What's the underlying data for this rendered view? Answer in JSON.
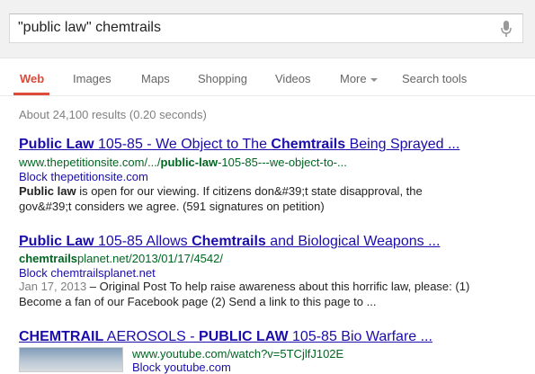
{
  "search": {
    "query": "\"public law\" chemtrails"
  },
  "tabs": [
    {
      "label": "Web"
    },
    {
      "label": "Images"
    },
    {
      "label": "Maps"
    },
    {
      "label": "Shopping"
    },
    {
      "label": "Videos"
    },
    {
      "label": "More"
    },
    {
      "label": "Search tools"
    }
  ],
  "stats": "About 24,100 results (0.20 seconds)",
  "results": [
    {
      "title_parts": [
        "Public Law",
        " 105-85 - We Object to The ",
        "Chemtrails",
        " Being Sprayed ..."
      ],
      "url_parts": [
        "www.thepetitionsite.com/.../",
        "public-law",
        "-105-85---we-object-to-..."
      ],
      "block": "Block thepetitionsite.com",
      "snippet_line1_parts": [
        "Public law",
        " is open for our viewing. If citizens don&#39;t state disapproval, the"
      ],
      "snippet_line2": "gov&#39;t considers we agree. (591 signatures on petition)"
    },
    {
      "title_parts": [
        "Public Law",
        " 105-85 Allows ",
        "Chemtrails",
        " and Biological Weapons ..."
      ],
      "url_parts": [
        "chemtrails",
        "planet.net/2013/01/17/4542/"
      ],
      "block": "Block chemtrailsplanet.net",
      "date": "Jan 17, 2013",
      "snippet_line1_rest": " – Original Post To help raise awareness about this horrific law, please: (1)",
      "snippet_line2": "Become a fan of our Facebook page (2) Send a link to this page to ..."
    },
    {
      "title_parts": [
        "CHEMTRAIL",
        " AEROSOLS - ",
        "PUBLIC LAW",
        " 105-85 Bio Warfare ..."
      ],
      "url": "www.youtube.com/watch?v=5TCjlfJ102E",
      "block": "Block youtube.com"
    }
  ],
  "colors": {
    "link": "#1a0dab",
    "url": "#006621",
    "active_tab": "#dd4b39"
  }
}
